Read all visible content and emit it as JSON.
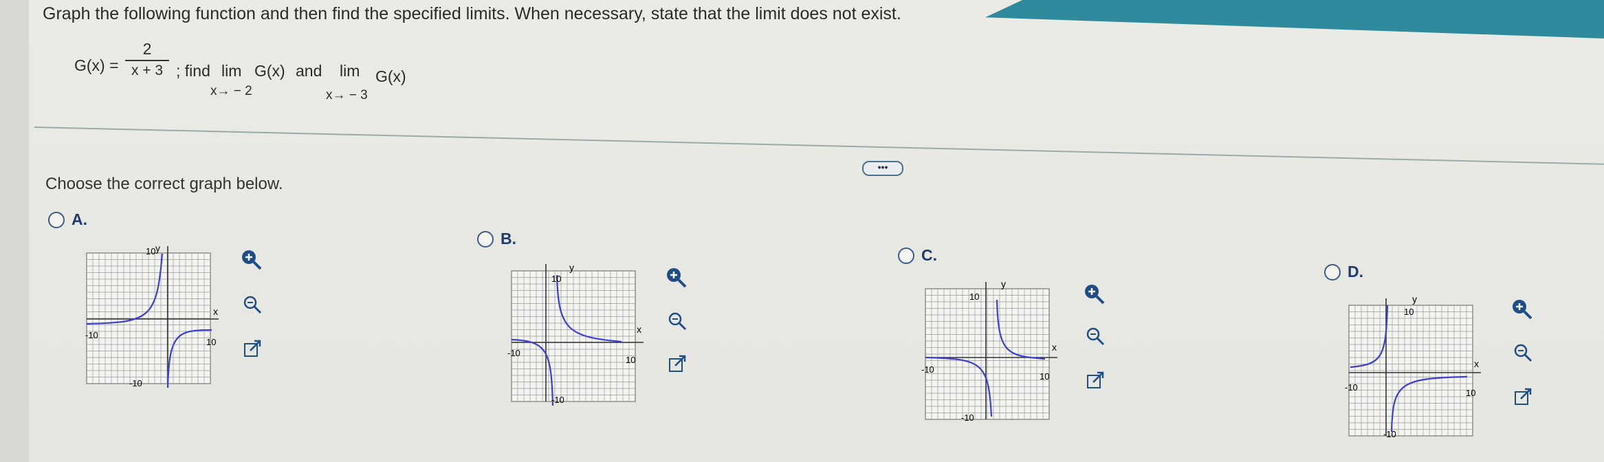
{
  "question": "Graph the following function and then find the specified limits. When necessary, state that the limit does not exist.",
  "formula": {
    "lhs": "G(x) =",
    "numerator": "2",
    "denominator": "x + 3",
    "find": "; find",
    "lim": "lim",
    "limit1_sub": "x→ − 2",
    "limit1_expr": "G(x)",
    "and": "and",
    "limit2_sub": "x→ − 3",
    "limit2_expr": "G(x)"
  },
  "more_label": "•••",
  "prompt": "Choose the correct graph below.",
  "options": [
    {
      "label": "A.",
      "y_label": "y",
      "x_label": "x",
      "top_tick": "10",
      "left_tick": "-10",
      "right_tick": "10",
      "bottom_tick": "-10"
    },
    {
      "label": "B.",
      "y_label": "y",
      "x_label": "x",
      "top_tick": "10",
      "left_tick": "-10",
      "right_tick": "10",
      "bottom_tick": "-10"
    },
    {
      "label": "C.",
      "y_label": "y",
      "x_label": "x",
      "top_tick": "10",
      "left_tick": "-10",
      "right_tick": "10",
      "bottom_tick": "-10"
    },
    {
      "label": "D.",
      "y_label": "y",
      "x_label": "x",
      "top_tick": "10",
      "left_tick": "-10",
      "right_tick": "10",
      "bottom_tick": "-10"
    }
  ],
  "icons": {
    "zoom_in": "zoom-in-icon",
    "zoom_out": "zoom-out-icon",
    "popout": "popout-icon"
  },
  "colors": {
    "curve": "#3b3fd6",
    "grid": "#9a9a9a",
    "accent": "#2f8a9e"
  }
}
